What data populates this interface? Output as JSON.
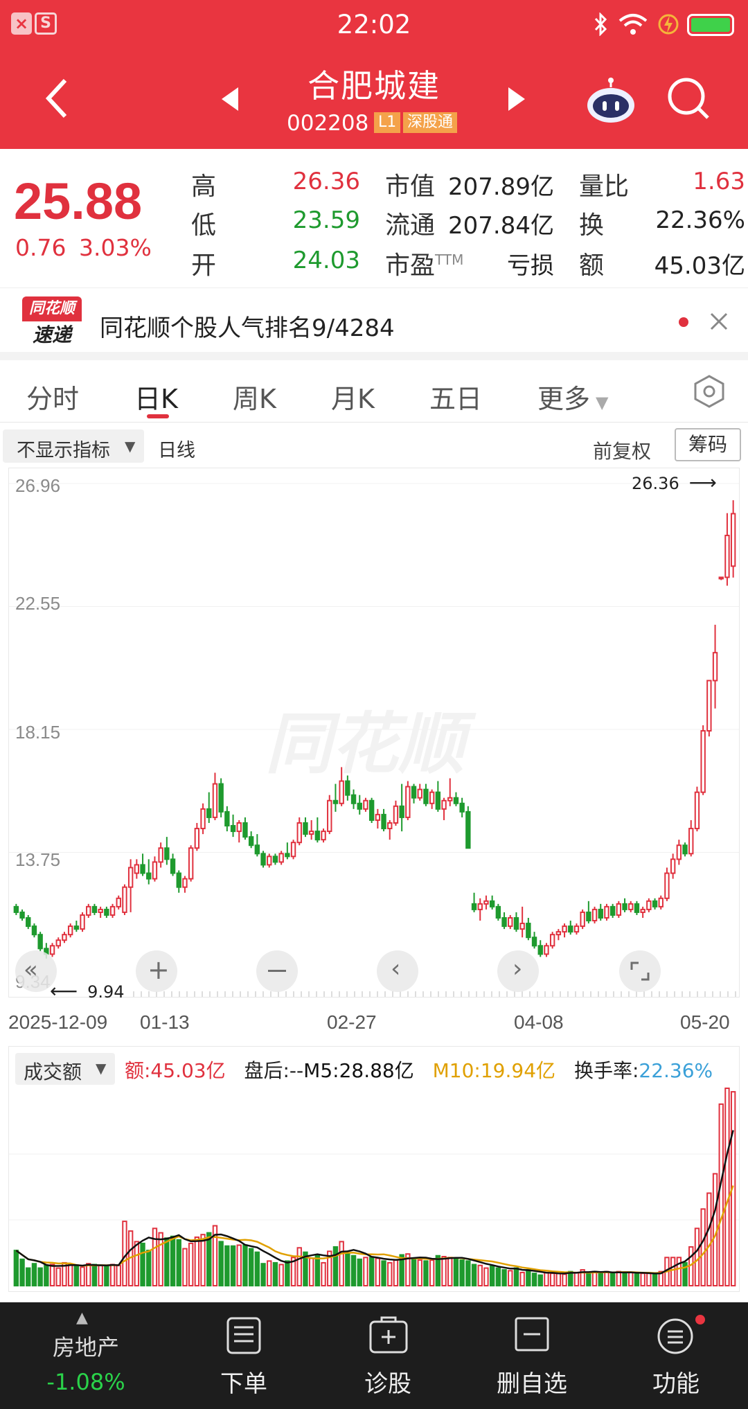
{
  "status": {
    "time": "22:02"
  },
  "header": {
    "name": "合肥城建",
    "code": "002208",
    "tag_level": "L1",
    "tag_connect": "深股通"
  },
  "quote": {
    "price": "25.88",
    "change": "0.76",
    "change_pct": "3.03%",
    "high_label": "高",
    "high": "26.36",
    "low_label": "低",
    "low": "23.59",
    "open_label": "开",
    "open": "24.03",
    "mktcap_label": "市值",
    "mktcap": "207.89亿",
    "float_label": "流通",
    "float": "207.84亿",
    "pe_label": "市盈",
    "pe_sup": "TTM",
    "pe": "亏损",
    "vr_label": "量比",
    "vr": "1.63",
    "turn_label": "换",
    "turn": "22.36%",
    "amt_label": "额",
    "amt": "45.03亿"
  },
  "news": {
    "logo_top": "同花顺",
    "logo_bottom": "速递",
    "text": "同花顺个股人气排名9/4284"
  },
  "tabs": [
    "分时",
    "日K",
    "周K",
    "月K",
    "五日",
    "更多"
  ],
  "indicator": {
    "selector": "不显示指标",
    "period": "日线",
    "adjust": "前复权",
    "chips": "筹码"
  },
  "chart": {
    "y_ticks": [
      "26.96",
      "22.55",
      "18.15",
      "13.75",
      "9.34"
    ],
    "max_label": "26.36",
    "min_label": "9.94",
    "dates": [
      "2025-12-09",
      "01-13",
      "02-27",
      "04-08",
      "05-20"
    ],
    "watermark": "同花顺"
  },
  "volume": {
    "selector": "成交额",
    "amt": "额:45.03亿",
    "after": "盘后:--",
    "m5": "M5:28.88亿",
    "m10": "M10:19.94亿",
    "turnover_label": "换手率:",
    "turnover": "22.36%"
  },
  "bottom": {
    "sector": "房地产",
    "sector_chg": "-1.08%",
    "items": [
      "下单",
      "诊股",
      "删自选",
      "功能"
    ]
  },
  "colors": {
    "header": "#e93540",
    "up": "#e0313e",
    "down": "#1e9a2e",
    "m5": "#111111",
    "m10": "#e0a000"
  },
  "chart_data": {
    "type": "candlestick",
    "ylim": [
      9.34,
      26.96
    ],
    "ohlc": [
      [
        11.8,
        11.9,
        11.5,
        11.6
      ],
      [
        11.6,
        11.7,
        11.3,
        11.4
      ],
      [
        11.4,
        11.5,
        11.0,
        11.1
      ],
      [
        11.1,
        11.2,
        10.7,
        10.8
      ],
      [
        10.8,
        10.9,
        10.2,
        10.3
      ],
      [
        10.3,
        10.5,
        9.94,
        10.1
      ],
      [
        10.1,
        10.5,
        10.0,
        10.4
      ],
      [
        10.4,
        10.7,
        10.3,
        10.6
      ],
      [
        10.6,
        10.9,
        10.5,
        10.8
      ],
      [
        10.8,
        11.2,
        10.7,
        11.1
      ],
      [
        11.1,
        11.3,
        10.9,
        11.0
      ],
      [
        11.0,
        11.6,
        10.9,
        11.5
      ],
      [
        11.5,
        11.9,
        11.4,
        11.8
      ],
      [
        11.8,
        11.9,
        11.5,
        11.6
      ],
      [
        11.6,
        11.8,
        11.4,
        11.7
      ],
      [
        11.7,
        11.8,
        11.4,
        11.5
      ],
      [
        11.5,
        11.9,
        11.4,
        11.8
      ],
      [
        11.8,
        12.2,
        11.7,
        12.1
      ],
      [
        11.6,
        12.6,
        11.5,
        12.5
      ],
      [
        12.5,
        13.5,
        11.6,
        13.2
      ],
      [
        13.0,
        13.5,
        12.8,
        13.3
      ],
      [
        13.3,
        13.7,
        12.9,
        13.0
      ],
      [
        13.0,
        13.5,
        12.6,
        12.8
      ],
      [
        12.8,
        13.6,
        12.7,
        13.4
      ],
      [
        13.4,
        14.1,
        13.2,
        13.9
      ],
      [
        13.9,
        14.3,
        13.3,
        13.5
      ],
      [
        13.5,
        13.7,
        12.9,
        13.0
      ],
      [
        13.0,
        13.1,
        12.3,
        12.5
      ],
      [
        12.5,
        12.9,
        12.3,
        12.8
      ],
      [
        12.8,
        14.0,
        12.7,
        13.9
      ],
      [
        13.9,
        14.8,
        13.8,
        14.6
      ],
      [
        14.6,
        15.5,
        14.4,
        15.3
      ],
      [
        15.3,
        15.9,
        14.8,
        15.0
      ],
      [
        15.0,
        16.6,
        14.9,
        16.2
      ],
      [
        16.2,
        16.4,
        15.0,
        15.2
      ],
      [
        15.2,
        15.4,
        14.5,
        14.7
      ],
      [
        14.7,
        15.1,
        14.3,
        14.5
      ],
      [
        14.5,
        14.9,
        14.1,
        14.8
      ],
      [
        14.8,
        15.0,
        14.2,
        14.3
      ],
      [
        14.3,
        14.5,
        13.9,
        14.0
      ],
      [
        14.0,
        14.4,
        13.6,
        13.7
      ],
      [
        13.7,
        13.8,
        13.2,
        13.3
      ],
      [
        13.3,
        13.7,
        13.2,
        13.6
      ],
      [
        13.6,
        13.7,
        13.3,
        13.4
      ],
      [
        13.4,
        13.8,
        13.3,
        13.7
      ],
      [
        13.7,
        14.1,
        13.5,
        13.6
      ],
      [
        13.6,
        14.2,
        13.5,
        14.1
      ],
      [
        14.1,
        15.0,
        14.0,
        14.8
      ],
      [
        14.8,
        15.0,
        14.3,
        14.4
      ],
      [
        14.4,
        14.9,
        14.2,
        14.5
      ],
      [
        14.5,
        15.0,
        14.1,
        14.2
      ],
      [
        14.2,
        14.6,
        14.1,
        14.5
      ],
      [
        14.5,
        15.8,
        14.4,
        15.6
      ],
      [
        15.6,
        16.2,
        15.2,
        15.5
      ],
      [
        15.5,
        16.8,
        15.4,
        16.3
      ],
      [
        16.3,
        16.5,
        15.6,
        15.8
      ],
      [
        15.8,
        16.0,
        15.3,
        15.5
      ],
      [
        15.5,
        15.8,
        15.1,
        15.3
      ],
      [
        15.3,
        15.7,
        15.2,
        15.6
      ],
      [
        15.6,
        15.7,
        14.8,
        14.9
      ],
      [
        14.9,
        15.3,
        14.6,
        15.1
      ],
      [
        15.1,
        15.3,
        14.5,
        14.6
      ],
      [
        14.6,
        14.9,
        14.2,
        14.8
      ],
      [
        14.8,
        15.6,
        14.7,
        15.4
      ],
      [
        15.4,
        16.2,
        14.5,
        15.0
      ],
      [
        15.0,
        16.3,
        14.9,
        16.1
      ],
      [
        16.1,
        16.2,
        15.5,
        15.7
      ],
      [
        15.7,
        16.2,
        15.6,
        16.0
      ],
      [
        16.0,
        16.2,
        15.4,
        15.5
      ],
      [
        15.5,
        16.0,
        15.3,
        15.9
      ],
      [
        15.9,
        16.3,
        15.2,
        15.3
      ],
      [
        15.3,
        15.7,
        14.9,
        15.6
      ],
      [
        15.6,
        16.4,
        15.4,
        15.7
      ],
      [
        15.7,
        15.9,
        15.4,
        15.5
      ],
      [
        15.5,
        15.7,
        15.0,
        15.2
      ],
      [
        15.2,
        15.4,
        13.9,
        13.9
      ],
      [
        11.9,
        12.3,
        11.6,
        11.7
      ],
      [
        11.7,
        12.1,
        11.3,
        11.9
      ],
      [
        11.9,
        12.2,
        11.7,
        12.0
      ],
      [
        12.0,
        12.2,
        11.7,
        11.8
      ],
      [
        11.8,
        11.9,
        11.3,
        11.4
      ],
      [
        11.4,
        11.6,
        11.0,
        11.1
      ],
      [
        11.1,
        11.5,
        11.0,
        11.4
      ],
      [
        11.4,
        11.6,
        10.9,
        11.0
      ],
      [
        11.0,
        11.8,
        10.7,
        11.2
      ],
      [
        11.2,
        11.4,
        10.6,
        10.7
      ],
      [
        10.7,
        10.9,
        10.3,
        10.4
      ],
      [
        10.4,
        10.6,
        10.0,
        10.1
      ],
      [
        10.1,
        10.5,
        10.0,
        10.4
      ],
      [
        10.4,
        10.9,
        10.3,
        10.8
      ],
      [
        10.8,
        11.0,
        10.6,
        10.9
      ],
      [
        10.9,
        11.2,
        10.7,
        11.1
      ],
      [
        11.1,
        11.3,
        10.8,
        10.9
      ],
      [
        10.9,
        11.2,
        10.8,
        11.1
      ],
      [
        11.1,
        11.7,
        11.0,
        11.6
      ],
      [
        11.6,
        12.0,
        11.2,
        11.3
      ],
      [
        11.3,
        11.8,
        11.2,
        11.7
      ],
      [
        11.7,
        11.9,
        11.3,
        11.4
      ],
      [
        11.4,
        11.9,
        11.3,
        11.8
      ],
      [
        11.8,
        11.9,
        11.4,
        11.5
      ],
      [
        11.5,
        12.0,
        11.4,
        11.9
      ],
      [
        11.9,
        12.1,
        11.6,
        11.7
      ],
      [
        11.7,
        12.0,
        11.6,
        11.9
      ],
      [
        11.9,
        12.0,
        11.5,
        11.6
      ],
      [
        11.6,
        11.8,
        11.4,
        11.7
      ],
      [
        11.7,
        12.1,
        11.6,
        12.0
      ],
      [
        12.0,
        12.1,
        11.7,
        11.8
      ],
      [
        11.8,
        12.2,
        11.7,
        12.1
      ],
      [
        12.1,
        13.2,
        12.0,
        13.0
      ],
      [
        13.0,
        13.7,
        12.8,
        13.5
      ],
      [
        13.5,
        14.2,
        13.3,
        14.0
      ],
      [
        14.0,
        14.1,
        13.6,
        13.7
      ],
      [
        13.7,
        14.9,
        13.6,
        14.6
      ],
      [
        14.6,
        16.1,
        14.5,
        15.9
      ],
      [
        15.9,
        18.3,
        15.8,
        18.1
      ],
      [
        18.1,
        19.9,
        17.9,
        19.9
      ],
      [
        19.9,
        21.9,
        18.9,
        20.9
      ],
      [
        23.6,
        23.6,
        23.5,
        23.6
      ],
      [
        23.6,
        25.9,
        23.3,
        25.1
      ],
      [
        24.0,
        26.36,
        23.59,
        25.88
      ]
    ],
    "amount": [
      4,
      3,
      2,
      2.5,
      2,
      2.3,
      2.4,
      2,
      2.6,
      2.4,
      2.3,
      2.1,
      2.5,
      2.4,
      2.3,
      2.2,
      2.4,
      2.3,
      7.3,
      6.2,
      5,
      4.8,
      4,
      6.5,
      6,
      5.4,
      5.6,
      5.2,
      4.2,
      4.8,
      5.5,
      5.8,
      6,
      6.8,
      5,
      4.5,
      4.5,
      4.6,
      4.6,
      4.2,
      3.8,
      2.5,
      2.8,
      2.6,
      2.4,
      2.8,
      3.2,
      4.3,
      3.8,
      3.1,
      3.4,
      2.6,
      3.9,
      4.4,
      5,
      3.6,
      3.4,
      3,
      3.2,
      3.2,
      3.1,
      2.8,
      2.6,
      2.9,
      3.5,
      3.6,
      3.1,
      2.9,
      2.8,
      2.9,
      3.4,
      3.3,
      3.2,
      3.0,
      2.9,
      2.8,
      2.4,
      2.3,
      2.0,
      2.2,
      2.0,
      1.8,
      1.7,
      2.0,
      1.5,
      1.8,
      1.4,
      1.2,
      1.5,
      1.4,
      1.5,
      1.3,
      1.6,
      1.5,
      1.8,
      1.5,
      1.6,
      1.4,
      1.6,
      1.4,
      1.6,
      1.5,
      1.5,
      1.3,
      1.4,
      1.4,
      1.3,
      1.6,
      3.2,
      3.2,
      3.2,
      2.6,
      4.4,
      6.5,
      8.7,
      10.5,
      12.7,
      20.6,
      22.4,
      22.0
    ]
  }
}
